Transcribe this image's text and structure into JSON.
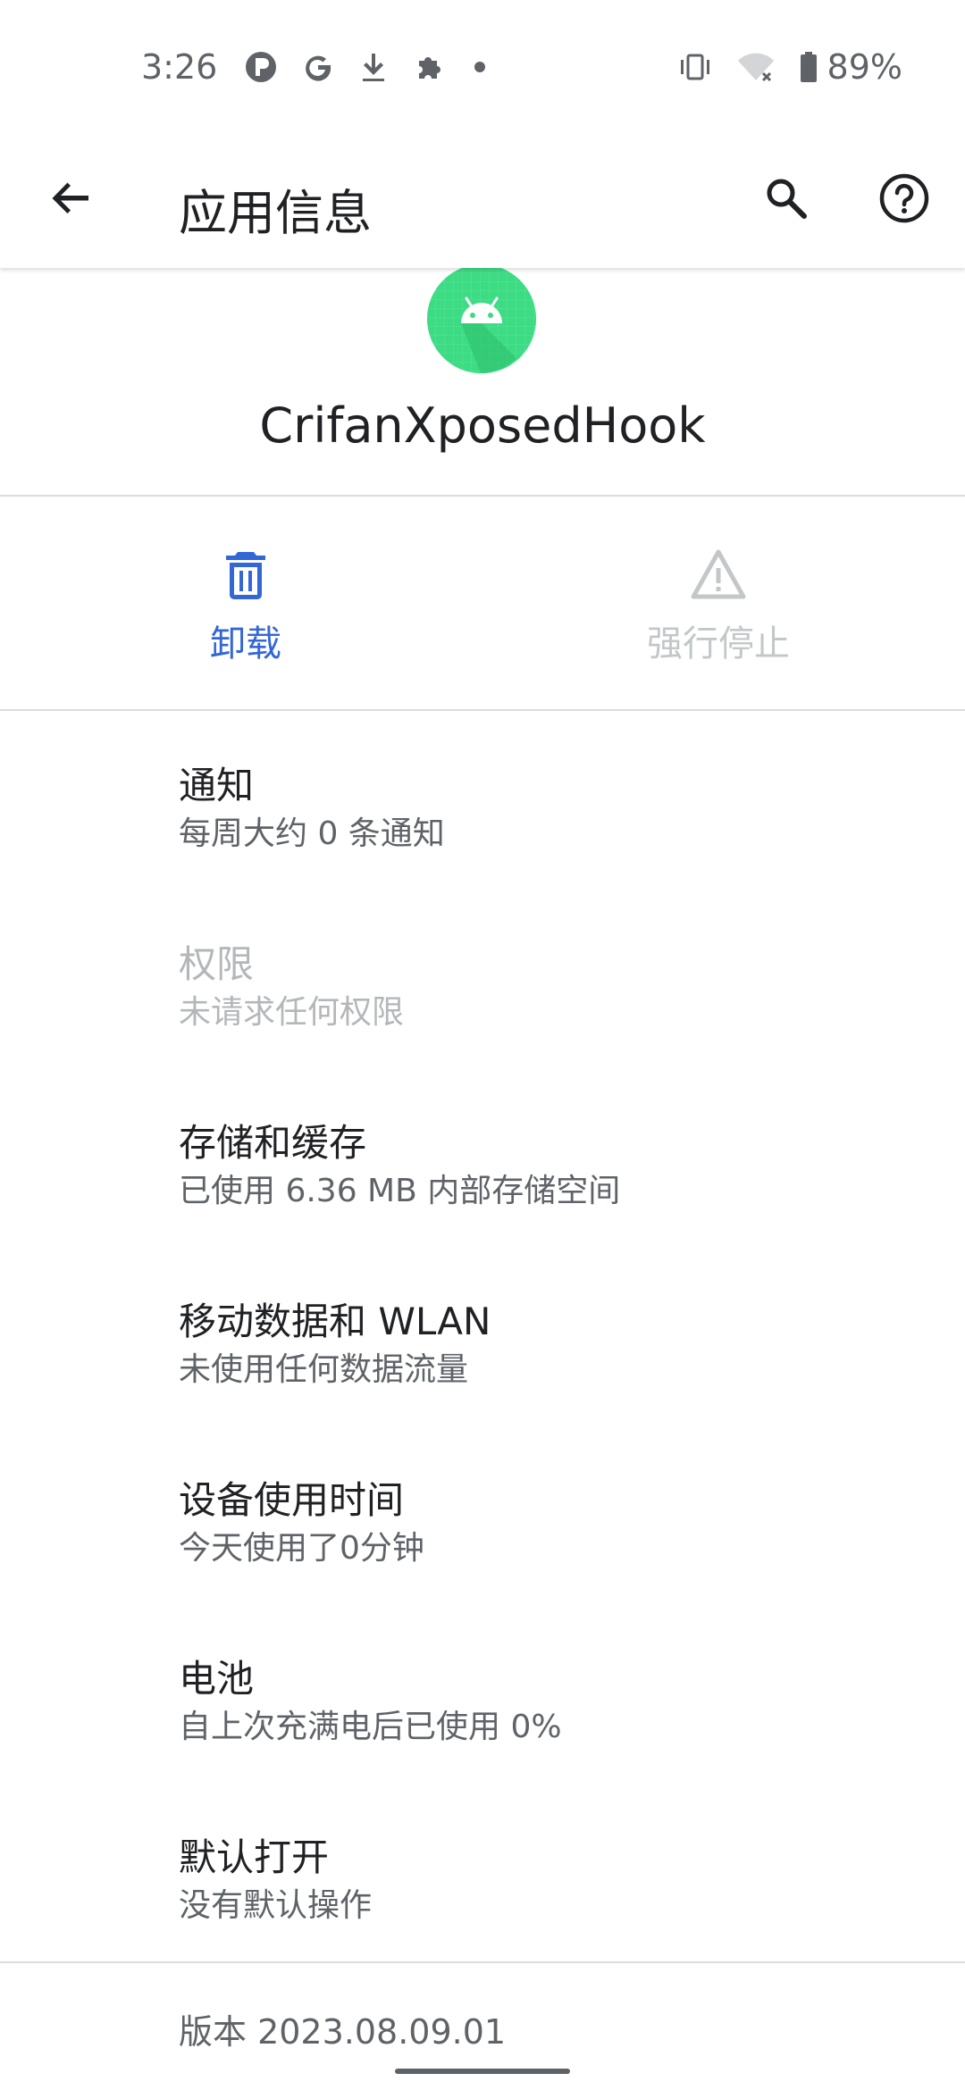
{
  "status_bar": {
    "time": "3:26",
    "battery_percent": "89%",
    "icons": [
      "p-icon",
      "google-icon",
      "download-icon",
      "puzzle-icon",
      "dot-icon",
      "vibrate-icon",
      "wifi-off-icon",
      "battery-icon"
    ]
  },
  "app_bar": {
    "title": "应用信息"
  },
  "app": {
    "name": "CrifanXposedHook",
    "icon_color": "#3ddc84"
  },
  "actions": [
    {
      "label": "卸载",
      "icon": "trash-icon",
      "enabled": true,
      "color": "#3367d6"
    },
    {
      "label": "强行停止",
      "icon": "warning-icon",
      "enabled": false,
      "color": "#c4c7c9"
    }
  ],
  "settings": [
    {
      "title": "通知",
      "summary": "每周大约 0 条通知",
      "enabled": true
    },
    {
      "title": "权限",
      "summary": "未请求任何权限",
      "enabled": false
    },
    {
      "title": "存储和缓存",
      "summary": "已使用 6.36 MB 内部存储空间",
      "enabled": true
    },
    {
      "title": "移动数据和 WLAN",
      "summary": "未使用任何数据流量",
      "enabled": true
    },
    {
      "title": "设备使用时间",
      "summary": "今天使用了0分钟",
      "enabled": true
    },
    {
      "title": "电池",
      "summary": "自上次充满电后已使用 0%",
      "enabled": true
    },
    {
      "title": "默认打开",
      "summary": "没有默认操作",
      "enabled": true
    }
  ],
  "footer": {
    "version": "版本 2023.08.09.01"
  }
}
